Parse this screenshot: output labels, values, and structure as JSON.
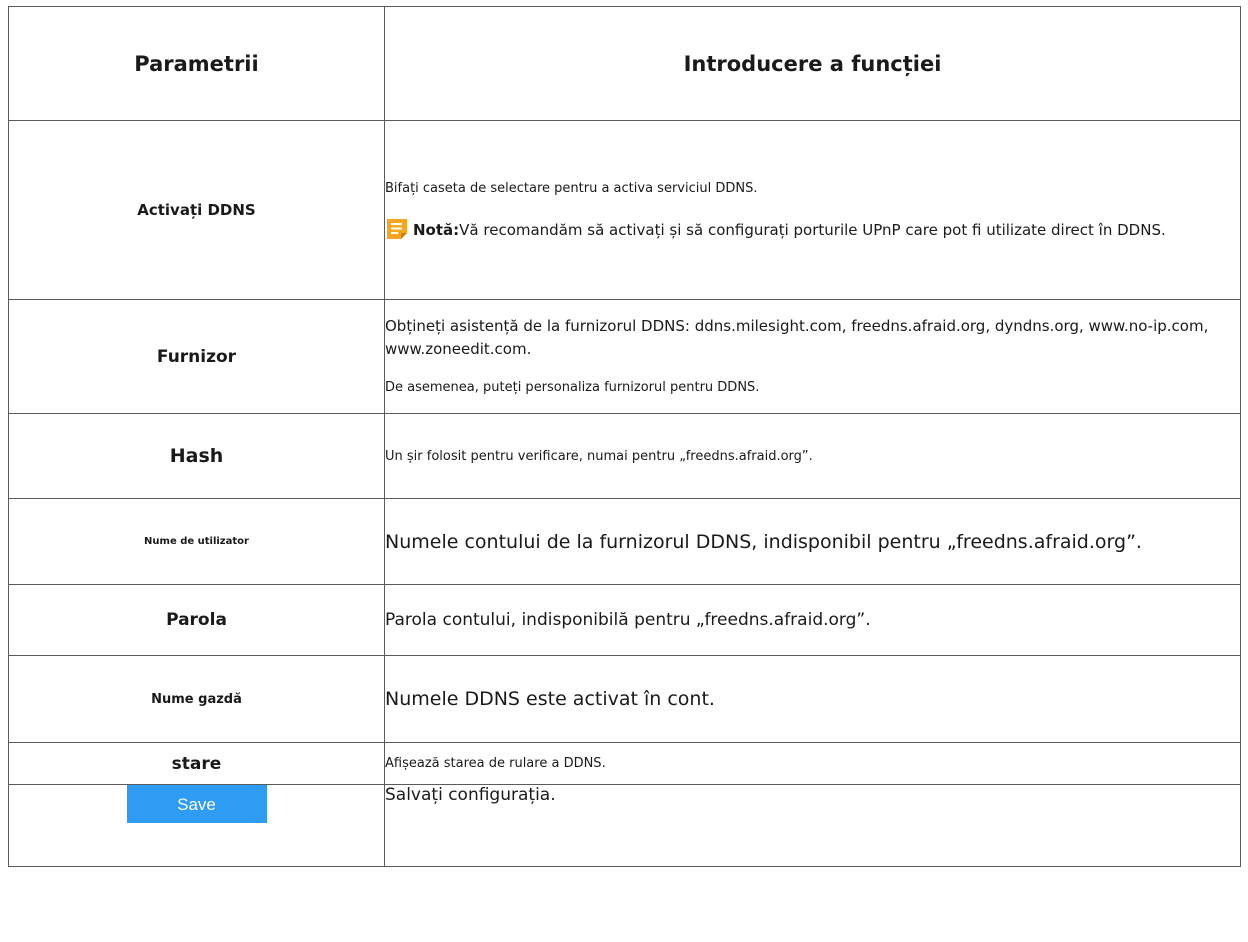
{
  "table": {
    "header": {
      "col1": "Parametrii",
      "col2": "Introducere a funcției"
    },
    "rows": [
      {
        "name": "Activați DDNS",
        "desc1": "Bifați caseta de selectare pentru a activa serviciul DDNS.",
        "note_label": "Notă:",
        "note_text": "Vă recomandăm să activați și să configurați porturile UPnP care pot fi utilizate direct în DDNS."
      },
      {
        "name": "Furnizor",
        "desc1": "Obțineți asistență de la furnizorul DDNS: ddns.milesight.com, freedns.afraid.org, dyndns.org, www.no-ip.com, www.zoneedit.com.",
        "desc2": "De asemenea, puteți personaliza furnizorul pentru DDNS."
      },
      {
        "name": "Hash",
        "desc": "Un șir folosit pentru verificare, numai pentru „freedns.afraid.org”."
      },
      {
        "name": "Nume de utilizator",
        "desc": "Numele contului de la furnizorul DDNS, indisponibil pentru „freedns.afraid.org”."
      },
      {
        "name": "Parola",
        "desc": "Parola contului, indisponibilă pentru „freedns.afraid.org”."
      },
      {
        "name": "Nume gazdă",
        "desc": "Numele DDNS este activat în cont."
      },
      {
        "name": "stare",
        "desc": "Afișează starea de rulare a DDNS."
      },
      {
        "button_label": "Save",
        "desc": "Salvați configurația."
      }
    ]
  },
  "colors": {
    "border": "#5b5b5b",
    "save_button": "#2d9cf2",
    "note_icon": "#f5a623"
  },
  "icons": {
    "note": "note-icon"
  }
}
